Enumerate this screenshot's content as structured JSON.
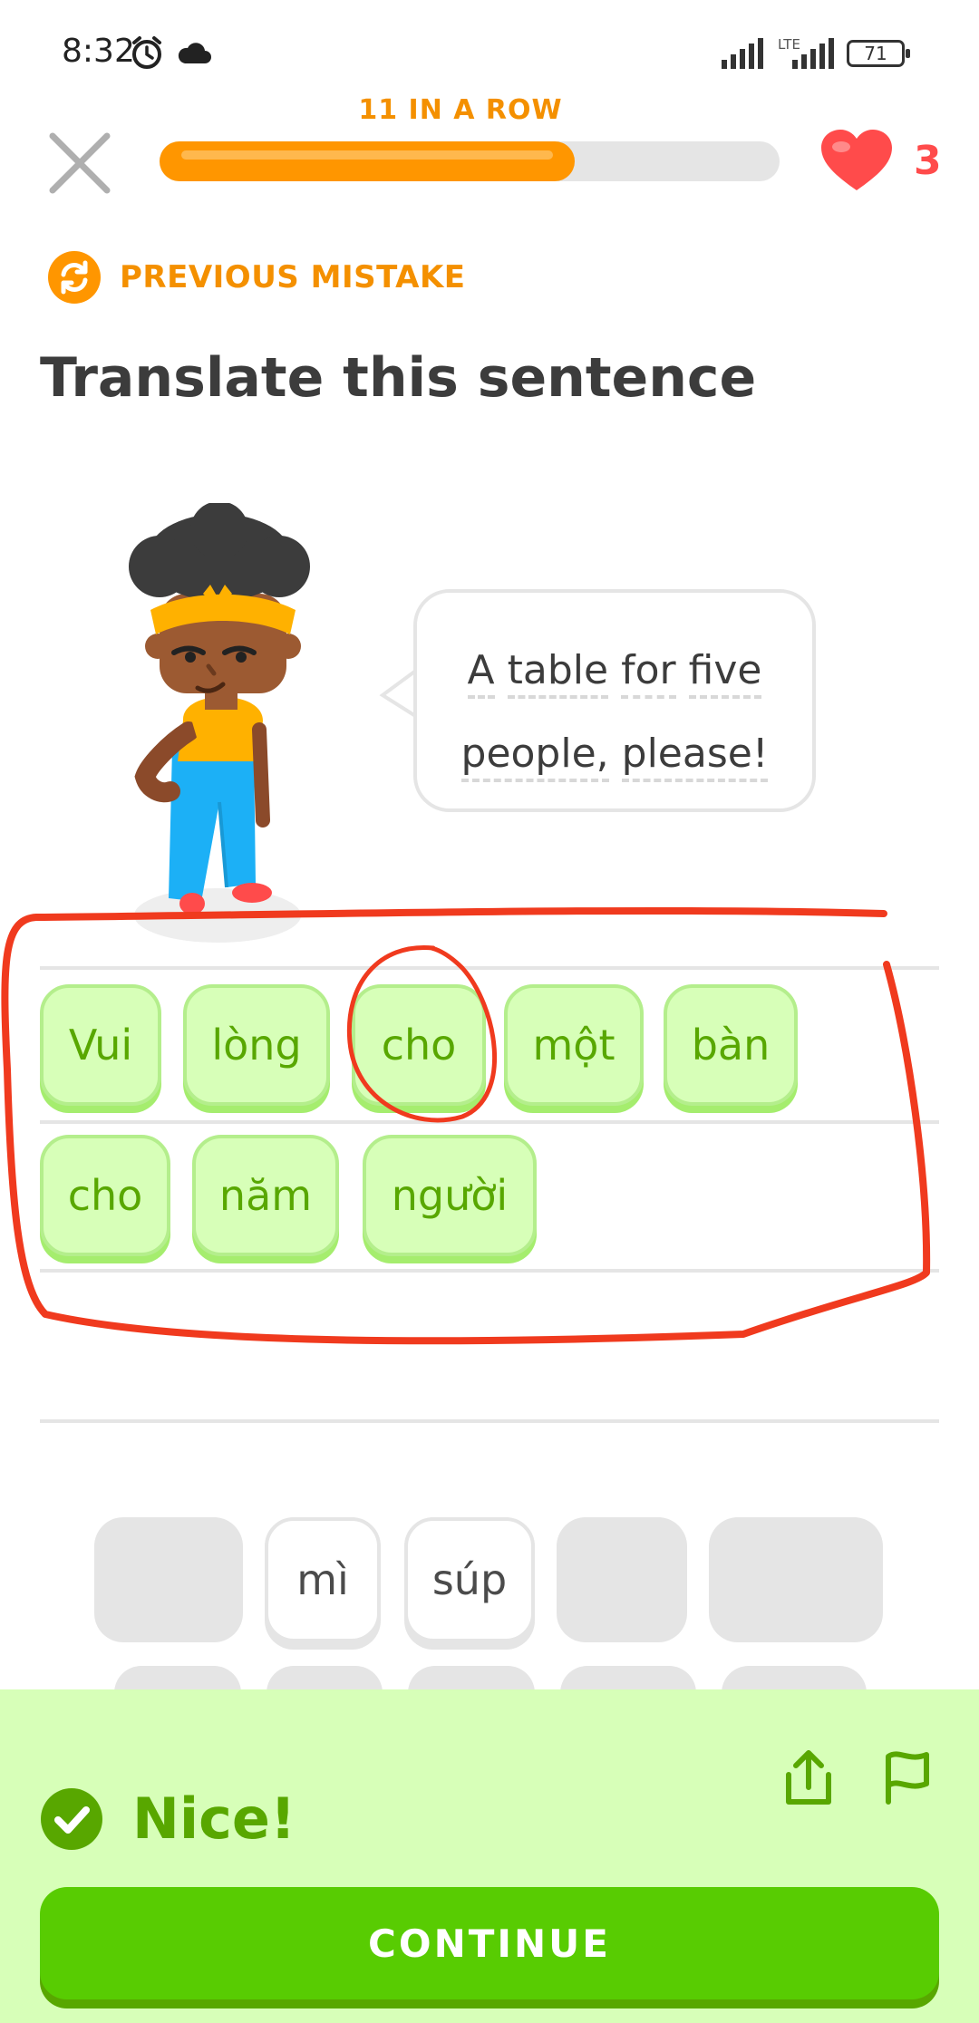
{
  "status": {
    "time": "8:32",
    "network": "LTE",
    "battery": "71",
    "icons": [
      "alarm-icon",
      "cloud-icon",
      "signal-icon",
      "battery-icon"
    ]
  },
  "header": {
    "streak_label": "11 IN A ROW",
    "progress": 0.67,
    "hearts_count": "3"
  },
  "prompt": {
    "mistake_label": "PREVIOUS MISTAKE",
    "title": "Translate this sentence",
    "sentence_words": [
      "A",
      "table",
      "for",
      "five",
      "people,",
      "please!"
    ]
  },
  "answer": {
    "row1": [
      "Vui",
      "lòng",
      "cho",
      "một",
      "bàn"
    ],
    "row2": [
      "cho",
      "năm",
      "người"
    ]
  },
  "word_bank": {
    "visible_words": [
      "mì",
      "súp"
    ]
  },
  "feedback": {
    "result_label": "Nice!",
    "continue_label": "CONTINUE"
  },
  "colors": {
    "accent_orange": "#ff9600",
    "heart_red": "#ff4b4b",
    "success_green": "#58cc02",
    "success_bg": "#d7ffb8",
    "annotation_red": "#f03a1e"
  }
}
